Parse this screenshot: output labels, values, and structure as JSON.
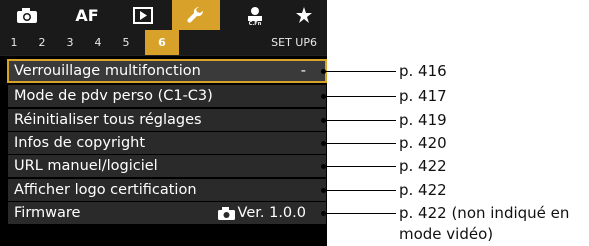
{
  "tabs": [
    {
      "name": "camera-icon",
      "label": ""
    },
    {
      "name": "af",
      "label": "AF"
    },
    {
      "name": "playback-icon",
      "label": ""
    },
    {
      "name": "setup-icon",
      "label": ""
    },
    {
      "name": "custom-icon",
      "label": ""
    },
    {
      "name": "star-icon",
      "label": ""
    }
  ],
  "subtabs": [
    "1",
    "2",
    "3",
    "4",
    "5",
    "6"
  ],
  "set_name": "SET UP6",
  "items": [
    {
      "label": "Verrouillage multifonction",
      "value": "-",
      "ref": "p. 416"
    },
    {
      "label": "Mode de pdv perso (C1-C3)",
      "value": "",
      "ref": "p. 417"
    },
    {
      "label": "Réinitialiser tous réglages",
      "value": "",
      "ref": "p. 419"
    },
    {
      "label": "Infos de copyright",
      "value": "",
      "ref": "p. 420"
    },
    {
      "label": "URL manuel/logiciel",
      "value": "",
      "ref": "p. 422"
    },
    {
      "label": "Afficher logo certification",
      "value": "",
      "ref": "p. 422"
    },
    {
      "label": "Firmware",
      "value": "Ver. 1.0.0",
      "ref": "p. 422 (non indiqué en"
    }
  ],
  "firmware_ref_line2": "mode vidéo)",
  "accent_color": "#d8a22a"
}
